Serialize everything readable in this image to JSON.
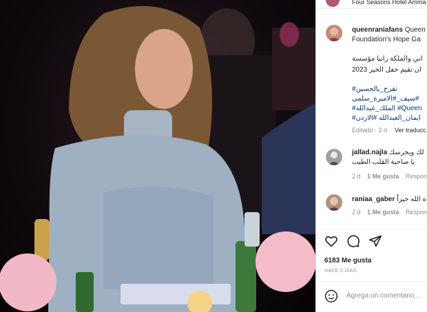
{
  "post": {
    "location": "Four Seasons Hotel Amma",
    "author": "queenraniafans",
    "caption_line1": "Queen",
    "caption_line2": "Foundation's Hope Ga",
    "caption_ar1": "اني والملكة رانيا مؤسسة",
    "caption_ar2": "ان تقيم حفل الخير 2023",
    "tags": [
      "#نفرح_بالحسين",
      "سيف_#الاميرة_سلمى#",
      "#الملك_عبدالله #Queen",
      "#ايمان_العبدالله #الاردن"
    ],
    "edited": "Editado · 2 d",
    "translate": "Ver traducc",
    "likes": "6183 Me gusta",
    "time_ago": "HACE 2 DÍAS",
    "comment_placeholder": "Agrega un comentario..."
  },
  "comments": [
    {
      "user": "jallad.najla",
      "text_inline": "لك ويحرسك",
      "text_line2": "يا صاحبة القلب الطيب",
      "time": "2 d",
      "likes": "1 Me gusta",
      "reply": "Respon"
    },
    {
      "user": "raniaa_gaber",
      "text_inline": "ه الله خيراً",
      "time": "2 d",
      "likes": "1 Me gusta",
      "reply": "Respon"
    }
  ],
  "colors": {
    "link": "#00376b",
    "muted": "#8e8e8e",
    "border": "#dbdbdb"
  }
}
